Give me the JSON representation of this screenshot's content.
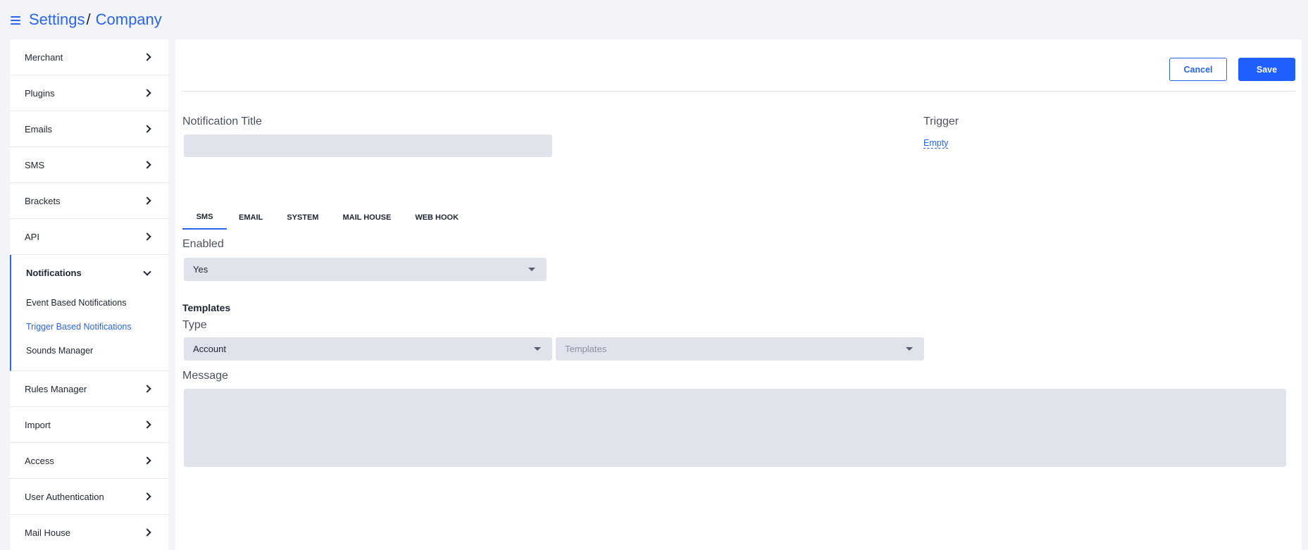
{
  "header": {
    "breadcrumb_root": "Settings",
    "breadcrumb_separator": "/",
    "breadcrumb_current": "Company"
  },
  "sidebar": {
    "items_top": [
      {
        "label": "Merchant"
      },
      {
        "label": "Plugins"
      },
      {
        "label": "Emails"
      },
      {
        "label": "SMS"
      },
      {
        "label": "Brackets"
      },
      {
        "label": "API"
      }
    ],
    "group": {
      "label": "Notifications",
      "sub_items": [
        {
          "label": "Event Based Notifications"
        },
        {
          "label": "Trigger Based Notifications"
        },
        {
          "label": "Sounds Manager"
        }
      ]
    },
    "items_bottom": [
      {
        "label": "Rules Manager"
      },
      {
        "label": "Import"
      },
      {
        "label": "Access"
      },
      {
        "label": "User Authentication"
      },
      {
        "label": "Mail House"
      }
    ]
  },
  "toolbar": {
    "cancel_label": "Cancel",
    "save_label": "Save"
  },
  "form": {
    "title_label": "Notification Title",
    "title_value": "",
    "trigger_label": "Trigger",
    "trigger_value": "Empty",
    "tabs": [
      {
        "label": "SMS"
      },
      {
        "label": "EMAIL"
      },
      {
        "label": "SYSTEM"
      },
      {
        "label": "MAIL HOUSE"
      },
      {
        "label": "WEB HOOK"
      }
    ],
    "enabled_label": "Enabled",
    "enabled_value": "Yes",
    "templates_heading": "Templates",
    "type_label": "Type",
    "type_value": "Account",
    "templates_placeholder": "Templates",
    "message_label": "Message",
    "message_value": ""
  },
  "colors": {
    "accent": "#2a64ef",
    "save_button": "#1f5fff",
    "field_bg": "#dfe3eb",
    "page_bg": "#f2f4f7"
  }
}
